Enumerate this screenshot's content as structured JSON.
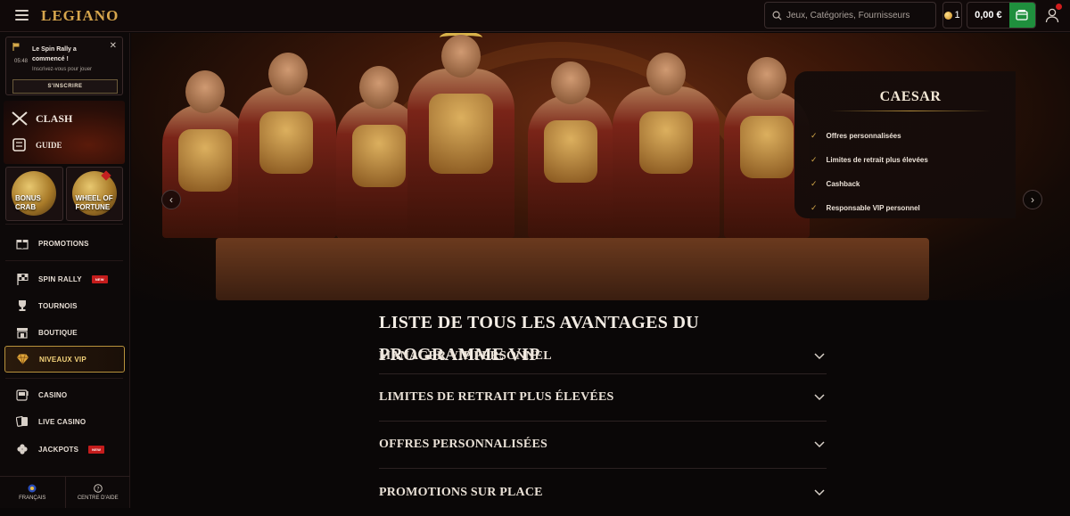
{
  "header": {
    "logo": "LEGIANO",
    "search_placeholder": "Jeux, Catégories, Fournisseurs",
    "coins": "1",
    "balance": "0,00 €"
  },
  "sidebar": {
    "notice": {
      "time": "05:48",
      "title": "Le Spin Rally a commencé !",
      "subtitle": "Inscrivez-vous pour jouer",
      "button": "S'INSCRIRE"
    },
    "promo": {
      "clash": "CLASH",
      "guide": "GUIDE"
    },
    "tiles": [
      {
        "label": "BONUS CRAB"
      },
      {
        "label": "WHEEL OF FORTUNE"
      }
    ],
    "nav": [
      {
        "label": "PROMOTIONS",
        "icon": "gift-icon"
      },
      {
        "label": "SPIN RALLY",
        "icon": "checkered-flag-icon",
        "badge": "NEW"
      },
      {
        "label": "TOURNOIS",
        "icon": "trophy-icon"
      },
      {
        "label": "BOUTIQUE",
        "icon": "shop-icon"
      },
      {
        "label": "NIVEAUX VIP",
        "icon": "diamond-icon",
        "active": true
      },
      {
        "label": "CASINO",
        "icon": "slot-machine-icon"
      },
      {
        "label": "LIVE CASINO",
        "icon": "cards-icon"
      },
      {
        "label": "JACKPOTS",
        "icon": "clover-icon",
        "badge": "NEW"
      }
    ],
    "footer": {
      "language": "FRANÇAIS",
      "help": "CENTRE D'AIDE"
    }
  },
  "hero": {
    "level_name": "CAESAR",
    "perks": [
      "Offres personnalisées",
      "Limites de retrait plus élevées",
      "Cashback",
      "Responsable VIP personnel"
    ]
  },
  "benefits": {
    "title": "Liste de tous les avantages du programme VIP",
    "items": [
      "Manager VIP personnel",
      "Limites de retrait plus élevées",
      "Offres personnalisées",
      "Promotions sur place"
    ]
  },
  "colors": {
    "accent_gold": "#d7a64d",
    "wallet_green": "#1f8f3d",
    "badge_red": "#c41c1c"
  }
}
